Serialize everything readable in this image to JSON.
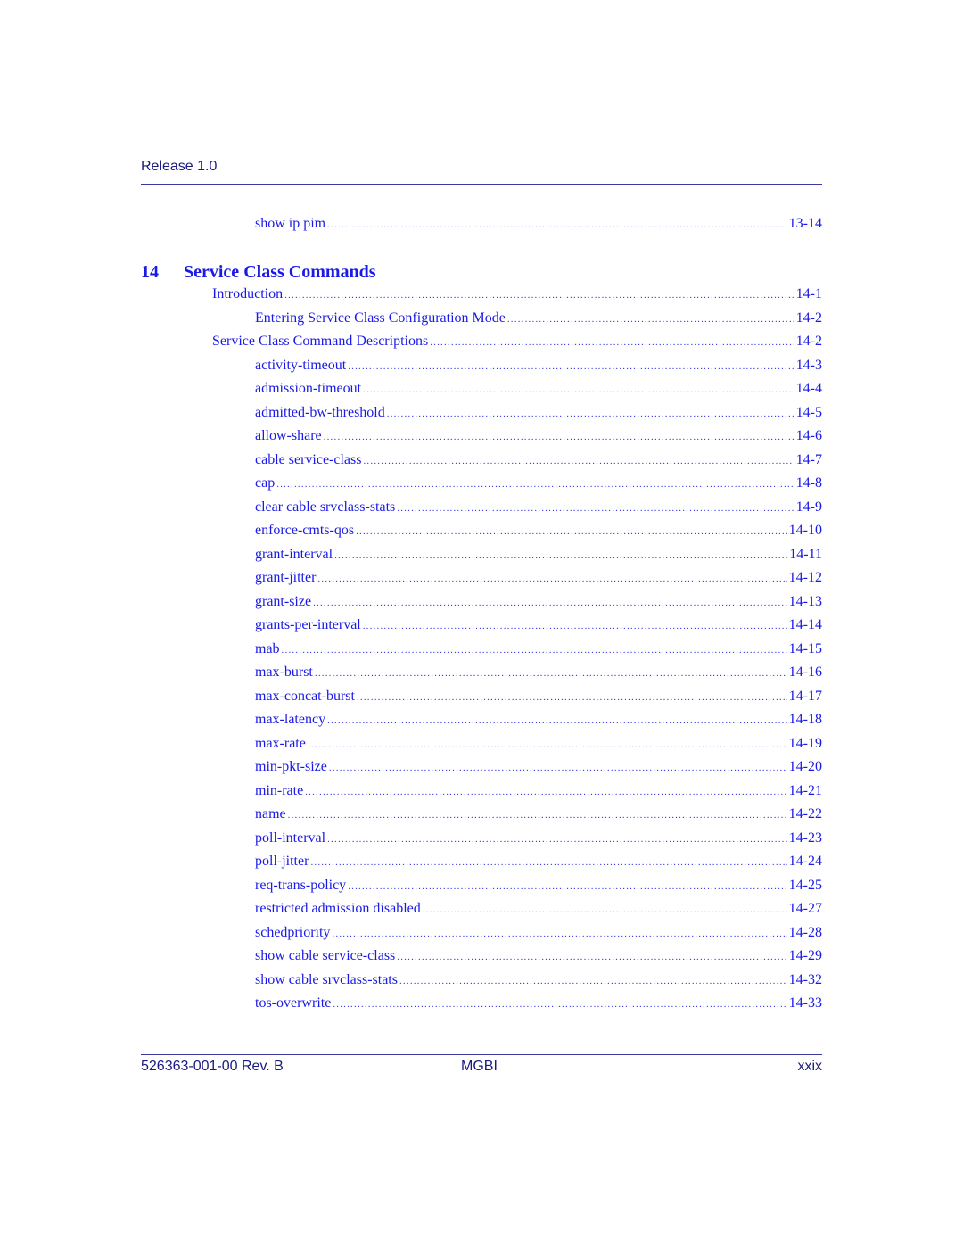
{
  "header": {
    "release": "Release 1.0"
  },
  "prev_entry": {
    "label": "show ip pim",
    "page": "13-14"
  },
  "chapter": {
    "number": "14",
    "title": "Service Class Commands"
  },
  "toc": [
    {
      "label": "Introduction",
      "page": "14-1",
      "level": 1
    },
    {
      "label": "Entering Service Class Configuration Mode",
      "page": "14-2",
      "level": 2
    },
    {
      "label": "Service Class Command Descriptions",
      "page": "14-2",
      "level": 1
    },
    {
      "label": "activity-timeout",
      "page": "14-3",
      "level": 2
    },
    {
      "label": "admission-timeout",
      "page": "14-4",
      "level": 2
    },
    {
      "label": "admitted-bw-threshold",
      "page": "14-5",
      "level": 2
    },
    {
      "label": "allow-share",
      "page": "14-6",
      "level": 2
    },
    {
      "label": "cable service-class",
      "page": "14-7",
      "level": 2
    },
    {
      "label": "cap",
      "page": "14-8",
      "level": 2
    },
    {
      "label": "clear cable srvclass-stats",
      "page": "14-9",
      "level": 2
    },
    {
      "label": "enforce-cmts-qos",
      "page": "14-10",
      "level": 2
    },
    {
      "label": "grant-interval",
      "page": "14-11",
      "level": 2
    },
    {
      "label": "grant-jitter",
      "page": "14-12",
      "level": 2
    },
    {
      "label": "grant-size",
      "page": "14-13",
      "level": 2
    },
    {
      "label": "grants-per-interval",
      "page": "14-14",
      "level": 2
    },
    {
      "label": "mab",
      "page": "14-15",
      "level": 2
    },
    {
      "label": "max-burst",
      "page": "14-16",
      "level": 2
    },
    {
      "label": "max-concat-burst",
      "page": "14-17",
      "level": 2
    },
    {
      "label": "max-latency",
      "page": "14-18",
      "level": 2
    },
    {
      "label": "max-rate",
      "page": "14-19",
      "level": 2
    },
    {
      "label": "min-pkt-size",
      "page": "14-20",
      "level": 2
    },
    {
      "label": "min-rate",
      "page": "14-21",
      "level": 2
    },
    {
      "label": "name",
      "page": "14-22",
      "level": 2
    },
    {
      "label": "poll-interval",
      "page": "14-23",
      "level": 2
    },
    {
      "label": "poll-jitter",
      "page": "14-24",
      "level": 2
    },
    {
      "label": "req-trans-policy",
      "page": "14-25",
      "level": 2
    },
    {
      "label": "restricted admission disabled",
      "page": "14-27",
      "level": 2
    },
    {
      "label": "schedpriority",
      "page": "14-28",
      "level": 2
    },
    {
      "label": "show cable service-class",
      "page": "14-29",
      "level": 2
    },
    {
      "label": "show cable srvclass-stats",
      "page": "14-32",
      "level": 2
    },
    {
      "label": "tos-overwrite",
      "page": "14-33",
      "level": 2
    }
  ],
  "footer": {
    "doc_number": "526363-001-00 Rev. B",
    "product": "MGBI",
    "page": "xxix"
  }
}
